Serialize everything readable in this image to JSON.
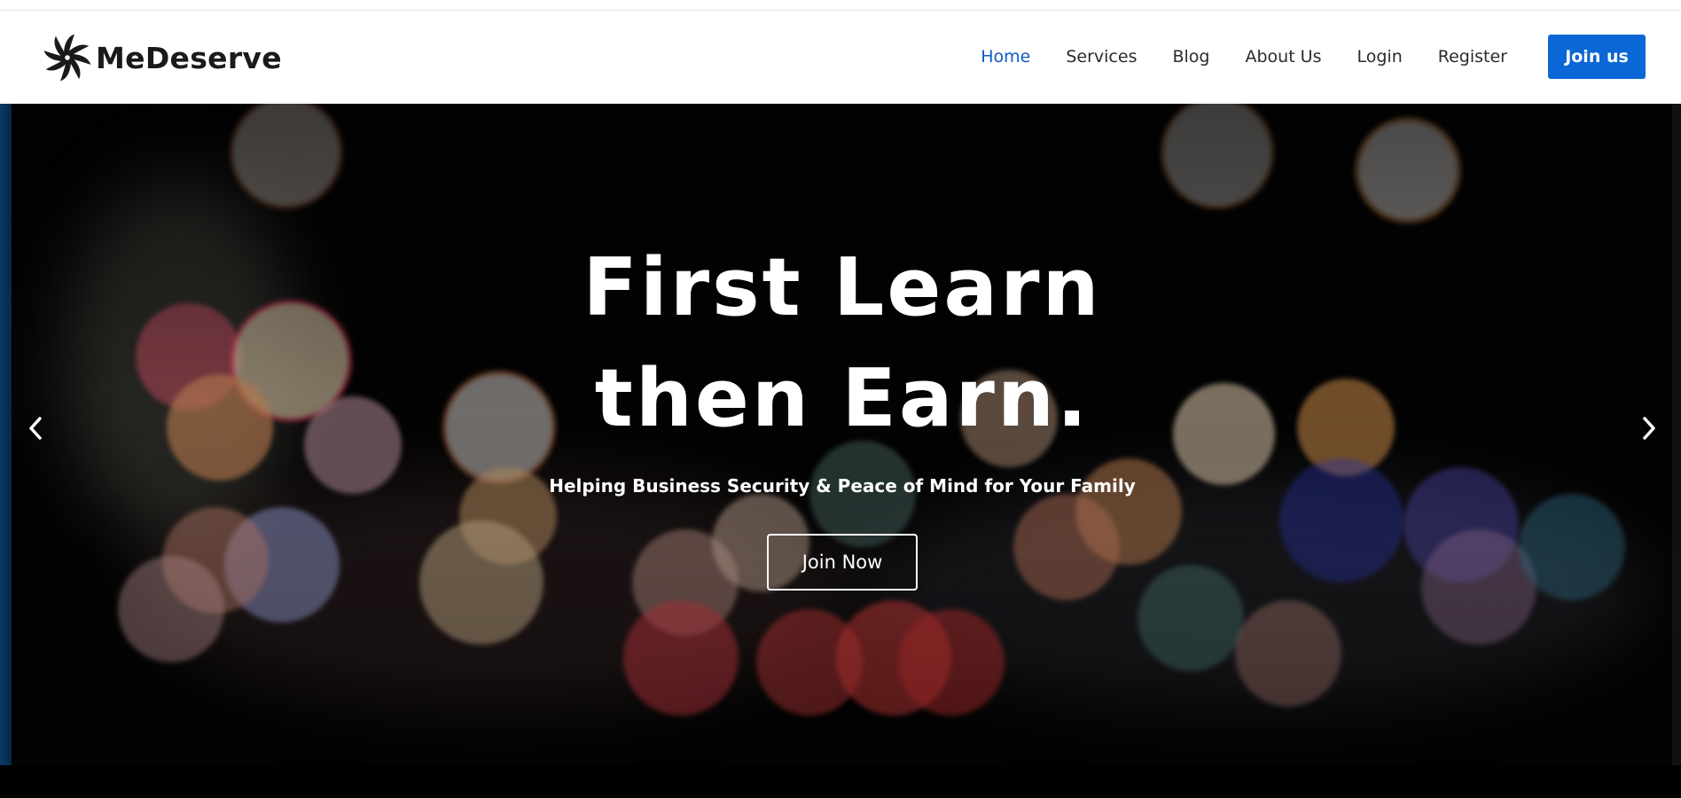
{
  "brand": {
    "name": "MeDeserve",
    "logo_icon": "pinwheel-logo-icon"
  },
  "nav": {
    "items": [
      {
        "label": "Home",
        "active": true
      },
      {
        "label": "Services",
        "active": false
      },
      {
        "label": "Blog",
        "active": false
      },
      {
        "label": "About Us",
        "active": false
      },
      {
        "label": "Login",
        "active": false
      },
      {
        "label": "Register",
        "active": false
      }
    ],
    "cta_label": "Join us"
  },
  "hero": {
    "headline_line1": "First Learn",
    "headline_line2": "then Earn.",
    "subtitle": "Helping Business Security & Peace of Mind for Your Family",
    "cta_label": "Join Now",
    "prev_icon": "chevron-left-icon",
    "next_icon": "chevron-right-icon"
  },
  "colors": {
    "accent": "#0b66d6",
    "active_nav": "#0d5bc6",
    "hero_bg": "#030303"
  }
}
